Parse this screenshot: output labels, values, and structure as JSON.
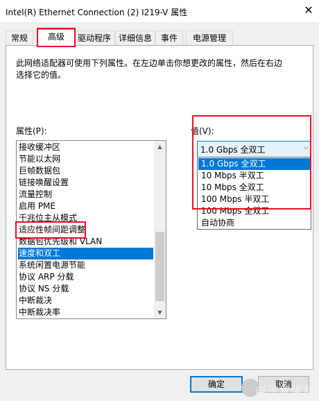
{
  "window": {
    "title": "Intel(R) Ethernet Connection (2) I219-V 属性",
    "close_glyph": "✕"
  },
  "tabs": [
    {
      "label": "常规",
      "active": false
    },
    {
      "label": "高级",
      "active": true
    },
    {
      "label": "驱动程序",
      "active": false
    },
    {
      "label": "详细信息",
      "active": false
    },
    {
      "label": "事件",
      "active": false
    },
    {
      "label": "电源管理",
      "active": false
    }
  ],
  "advanced": {
    "description": "此网络适配器可使用下列属性。在左边单击你想更改的属性，然后在右边选择它的值。",
    "property_label": "属性(P):",
    "value_label": "值(V):",
    "properties": [
      "接收缓冲区",
      "节能以太网",
      "巨帧数据包",
      "链接唤醒设置",
      "流量控制",
      "启用 PME",
      "千兆位主从模式",
      "适应性帧间距调整",
      "数据包优先级和 VLAN",
      "速度和双工",
      "系统闲置电源节能",
      "协议 ARP 分载",
      "协议 NS 分载",
      "中断裁决",
      "中断裁决率"
    ],
    "selected_property": "速度和双工",
    "value_current": "1.0 Gbps 全双工",
    "value_options": [
      "1.0 Gbps 全双工",
      "10 Mbps 半双工",
      "10 Mbps 全双工",
      "100 Mbps 半双工",
      "100 Mbps 全双工",
      "自动协商"
    ],
    "selected_option": "1.0 Gbps 全双工"
  },
  "buttons": {
    "ok": "确定",
    "cancel": "取消"
  },
  "watermark": {
    "text": "电子发烧友"
  },
  "colors": {
    "selection": "#0078d7",
    "highlight_box": "#e81123",
    "dialog_bg": "#f0f0f0"
  },
  "icons": {
    "close": "close-icon",
    "dropdown": "chevron-down-icon",
    "scroll_up": "scroll-up-arrow-icon",
    "scroll_down": "scroll-down-arrow-icon"
  }
}
